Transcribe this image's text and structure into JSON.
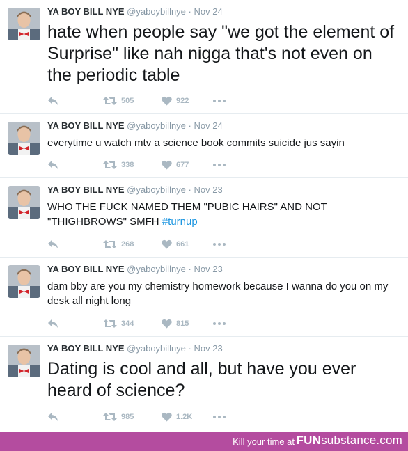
{
  "tweets": [
    {
      "name": "YA BOY BILL NYE",
      "handle": "@yaboybillnye",
      "separator": "·",
      "date": "Nov 24",
      "text": "hate when people say \"we got the element of Surprise\" like nah nigga that's not even on the periodic table",
      "hashtag": "",
      "retweets": "505",
      "likes": "922"
    },
    {
      "name": "YA BOY BILL NYE",
      "handle": "@yaboybillnye",
      "separator": "·",
      "date": "Nov 24",
      "text": "everytime u watch mtv a science book commits suicide jus sayin",
      "hashtag": "",
      "retweets": "338",
      "likes": "677"
    },
    {
      "name": "YA BOY BILL NYE",
      "handle": "@yaboybillnye",
      "separator": "·",
      "date": "Nov 23",
      "text": "WHO THE FUCK NAMED THEM \"PUBIC HAIRS\" AND NOT \"THIGHBROWS\" SMFH ",
      "hashtag": "#turnup",
      "retweets": "268",
      "likes": "661"
    },
    {
      "name": "YA BOY BILL NYE",
      "handle": "@yaboybillnye",
      "separator": "·",
      "date": "Nov 23",
      "text": "dam bby are you my chemistry homework because I wanna do you on my desk all night long",
      "hashtag": "",
      "retweets": "344",
      "likes": "815"
    },
    {
      "name": "YA BOY BILL NYE",
      "handle": "@yaboybillnye",
      "separator": "·",
      "date": "Nov 23",
      "text": "Dating is cool and all, but have you ever heard of science?",
      "hashtag": "",
      "retweets": "985",
      "likes": "1.2K"
    }
  ],
  "icons": {
    "reply": "reply-icon",
    "retweet": "retweet-icon",
    "like": "heart-icon",
    "more": "more-dots-icon"
  },
  "colors": {
    "action_gray": "#aab8c2",
    "hashtag_blue": "#1b95e0",
    "footer_purple": "#b44c9f"
  },
  "footer": {
    "tagline": "Kill your time at",
    "brand_bold": "FUN",
    "brand_rest": "substance.com"
  }
}
